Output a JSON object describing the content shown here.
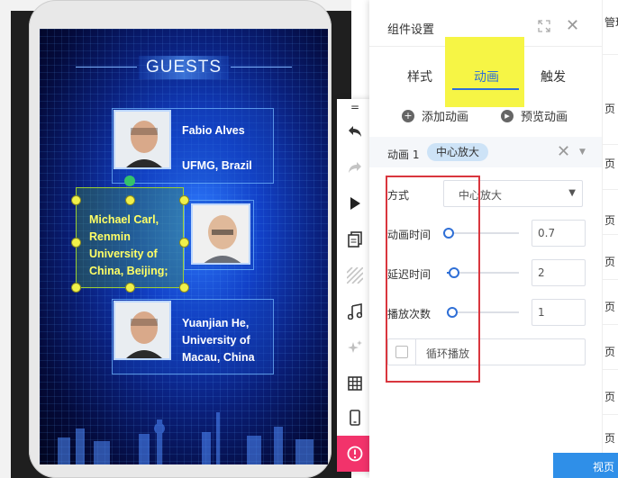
{
  "canvas": {
    "title": "GUESTS",
    "guests": [
      {
        "name": "Fabio Alves",
        "affiliation": "UFMG, Brazil"
      },
      {
        "lines": [
          "Michael Carl,",
          "Renmin",
          "University of",
          "China, Beijing;"
        ]
      },
      {
        "lines": [
          "Yuanjian He,",
          "University of",
          "Macau, China"
        ]
      }
    ]
  },
  "toolbar": {
    "icons": [
      "menu-icon",
      "undo-icon",
      "redo-icon",
      "play-icon",
      "copy-icon",
      "texture-icon",
      "music-icon",
      "sparkle-icon",
      "table-icon",
      "mobile-icon",
      "alert-icon"
    ],
    "menu_label": "="
  },
  "panel": {
    "title": "组件设置",
    "tabs": [
      "样式",
      "动画",
      "触发"
    ],
    "active_tab": "动画",
    "actions": {
      "add": "添加动画",
      "preview": "预览动画"
    },
    "animation": {
      "label": "动画 1",
      "tag": "中心放大",
      "method_label": "方式",
      "method_value": "中心放大",
      "duration_label": "动画时间",
      "duration_value": "0.7",
      "delay_label": "延迟时间",
      "delay_value": "2",
      "count_label": "播放次数",
      "count_value": "1",
      "loop_label": "循环播放"
    }
  },
  "right_strip": {
    "texts": [
      "管理",
      "页",
      "页",
      "页",
      "页",
      "页",
      "页",
      "页",
      "页"
    ],
    "preview_button": "视页"
  },
  "colors": {
    "accent": "#2f6fd6",
    "highlight": "#f6f545",
    "outline": "#d9363e",
    "alert": "#f2336b"
  }
}
